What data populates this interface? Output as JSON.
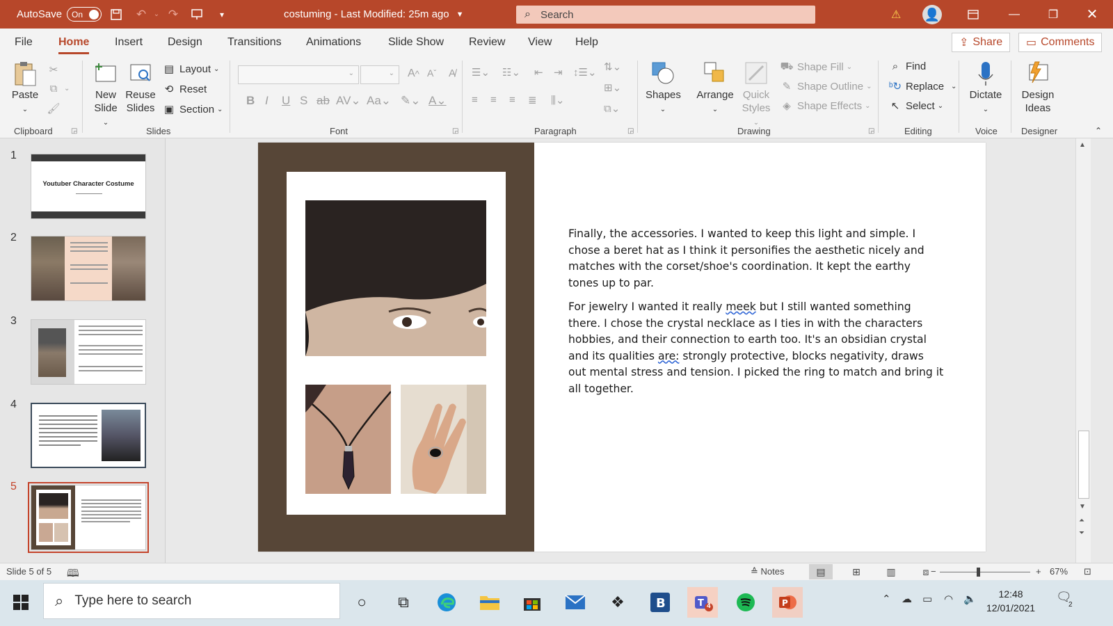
{
  "titlebar": {
    "autosave_label": "AutoSave",
    "autosave_state": "On",
    "doc_title": "costuming  -  Last Modified: 25m ago",
    "search_placeholder": "Search",
    "accent_color": "#b7472a"
  },
  "tabs": [
    {
      "label": "File"
    },
    {
      "label": "Home"
    },
    {
      "label": "Insert"
    },
    {
      "label": "Design"
    },
    {
      "label": "Transitions"
    },
    {
      "label": "Animations"
    },
    {
      "label": "Slide Show"
    },
    {
      "label": "Review"
    },
    {
      "label": "View"
    },
    {
      "label": "Help"
    }
  ],
  "share_label": "Share",
  "comments_label": "Comments",
  "ribbon": {
    "clipboard": {
      "label": "Clipboard",
      "paste": "Paste"
    },
    "slides": {
      "label": "Slides",
      "new_slide_1": "New",
      "new_slide_2": "Slide",
      "reuse_1": "Reuse",
      "reuse_2": "Slides",
      "layout": "Layout",
      "reset": "Reset",
      "section": "Section"
    },
    "font": {
      "label": "Font"
    },
    "paragraph": {
      "label": "Paragraph"
    },
    "drawing": {
      "label": "Drawing",
      "shapes": "Shapes",
      "arrange": "Arrange",
      "quick_1": "Quick",
      "quick_2": "Styles",
      "shape_fill": "Shape Fill",
      "shape_outline": "Shape Outline",
      "shape_effects": "Shape Effects"
    },
    "editing": {
      "label": "Editing",
      "find": "Find",
      "replace": "Replace",
      "select": "Select"
    },
    "voice": {
      "label": "Voice",
      "dictate": "Dictate"
    },
    "designer": {
      "label": "Designer",
      "design_1": "Design",
      "design_2": "Ideas"
    }
  },
  "thumbnails": [
    {
      "num": "1",
      "title": "Youtuber Character Costume"
    },
    {
      "num": "2"
    },
    {
      "num": "3"
    },
    {
      "num": "4"
    },
    {
      "num": "5"
    }
  ],
  "slide": {
    "para1": "Finally, the accessories. I wanted to keep this light and simple. I chose a beret hat as I think it personifies the aesthetic nicely and matches with the corset/shoe's coordination. It kept the earthy tones up to par.",
    "para2_a": "For jewelry I wanted it really ",
    "para2_sq1": "meek",
    "para2_b": " but I still wanted something there. I chose the crystal necklace as I ties in with the characters hobbies, and their connection to earth too. It's an obsidian crystal and its qualities ",
    "para2_sq2": "are:",
    "para2_c": " strongly protective, blocks negativity, draws out mental stress and tension. I picked the ring to match and bring it all together."
  },
  "statusbar": {
    "slide_info": "Slide 5 of 5",
    "notes": "Notes",
    "zoom": "67%"
  },
  "taskbar": {
    "search_placeholder": "Type here to search",
    "time": "12:48",
    "date": "12/01/2021",
    "teams_badge": "4",
    "notif_badge": "2"
  }
}
